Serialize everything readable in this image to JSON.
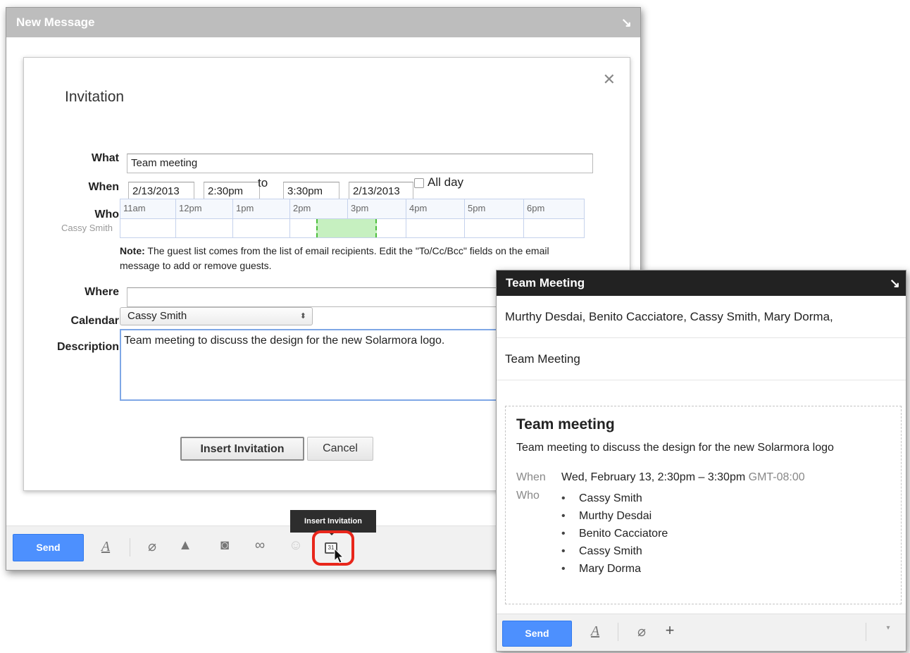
{
  "compose": {
    "title": "New Message",
    "collapse_icon": "↘",
    "send_label": "Send",
    "tooltip": "Insert Invitation",
    "calendar_icon_text": "31"
  },
  "dialog": {
    "title": "Invitation",
    "close_icon": "✕",
    "labels": {
      "what": "What",
      "when": "When",
      "who": "Who",
      "where": "Where",
      "calendar": "Calendar",
      "description": "Description"
    },
    "what_value": "Team meeting",
    "start_date": "2/13/2013",
    "start_time": "2:30pm",
    "to_label": "to",
    "end_time": "3:30pm",
    "end_date": "2/13/2013",
    "all_day_label": "All day",
    "timeline_hours": [
      "11am",
      "12pm",
      "1pm",
      "2pm",
      "3pm",
      "4pm",
      "5pm",
      "6pm"
    ],
    "guest_name": "Cassy Smith",
    "note_bold": "Note:",
    "note_text": " The guest list comes from the list of email recipients. Edit the \"To/Cc/Bcc\" fields on the email message to add or remove guests.",
    "where_value": "",
    "calendar_value": "Cassy Smith",
    "description_value": "Team meeting to discuss the design for the new Solarmora logo.",
    "insert_button": "Insert Invitation",
    "cancel_button": "Cancel"
  },
  "message": {
    "title": "Team Meeting",
    "collapse_icon": "↘",
    "recipients": "Murthy Desdai, Benito Cacciatore, Cassy Smith, Mary Dorma,",
    "subject": "Team Meeting",
    "card": {
      "title": "Team meeting",
      "description": "Team meeting to discuss the design for the new Solarmora logo",
      "when_label": "When",
      "when_value": "Wed, February 13, 2:30pm – 3:30pm",
      "timezone": "GMT-08:00",
      "who_label": "Who",
      "guests": [
        "Cassy Smith",
        "Murthy Desdai",
        "Benito Cacciatore",
        "Cassy Smith",
        "Mary Dorma"
      ]
    },
    "send_label": "Send"
  }
}
